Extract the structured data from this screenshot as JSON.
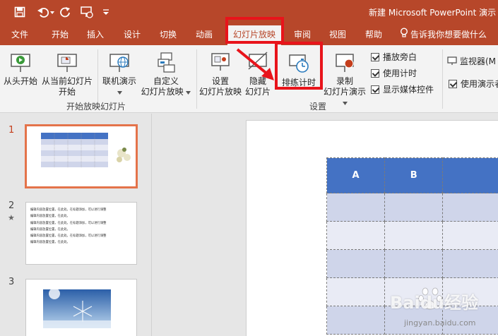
{
  "title": "新建 Microsoft PowerPoint 演示",
  "tabs": [
    {
      "label": "文件"
    },
    {
      "label": "开始"
    },
    {
      "label": "插入"
    },
    {
      "label": "设计"
    },
    {
      "label": "切换"
    },
    {
      "label": "动画"
    },
    {
      "label": "幻灯片放映"
    },
    {
      "label": "审阅"
    },
    {
      "label": "视图"
    },
    {
      "label": "帮助"
    },
    {
      "label": "告诉我你想要做什么"
    }
  ],
  "ribbon": {
    "from_beginning": "从头开始",
    "from_current_1": "从当前幻灯片",
    "from_current_2": "开始",
    "online_present": "联机演示",
    "custom_show_1": "自定义",
    "custom_show_2": "幻灯片放映",
    "group_start": "开始放映幻灯片",
    "setup_show_1": "设置",
    "setup_show_2": "幻灯片放映",
    "hide_slide_1": "隐藏",
    "hide_slide_2": "幻灯片",
    "rehearse": "排练计时",
    "record_1": "录制",
    "record_2": "幻灯片演示",
    "group_setup": "设置",
    "play_narration": "播放旁白",
    "use_timings": "使用计时",
    "show_media_controls": "显示媒体控件",
    "monitor": "监视器(M",
    "use_presenter_view": "使用演示者"
  },
  "slides": [
    {
      "num": "1"
    },
    {
      "num": "2",
      "marker": "★"
    },
    {
      "num": "3"
    }
  ],
  "slide2_lines": [
    "编辑内容放置位置，在此处。在标题添加，可以进行调整",
    "编辑内容放置位置，在此处。",
    "编辑内容放置位置，在此处。在标题添加，可以进行调整",
    "编辑内容放置位置，在此处。",
    "编辑内容放置位置，在此处。在标题添加，可以进行调整",
    "编辑内容放置位置，在此处。"
  ],
  "table": {
    "headers": [
      "A",
      "B",
      ""
    ]
  },
  "watermark": {
    "brand": "Baidu经验",
    "url": "jingyan.baidu.com"
  },
  "colors": {
    "accent": "#b7472a",
    "highlight_box": "#e8141b",
    "table_header": "#4472c4"
  }
}
